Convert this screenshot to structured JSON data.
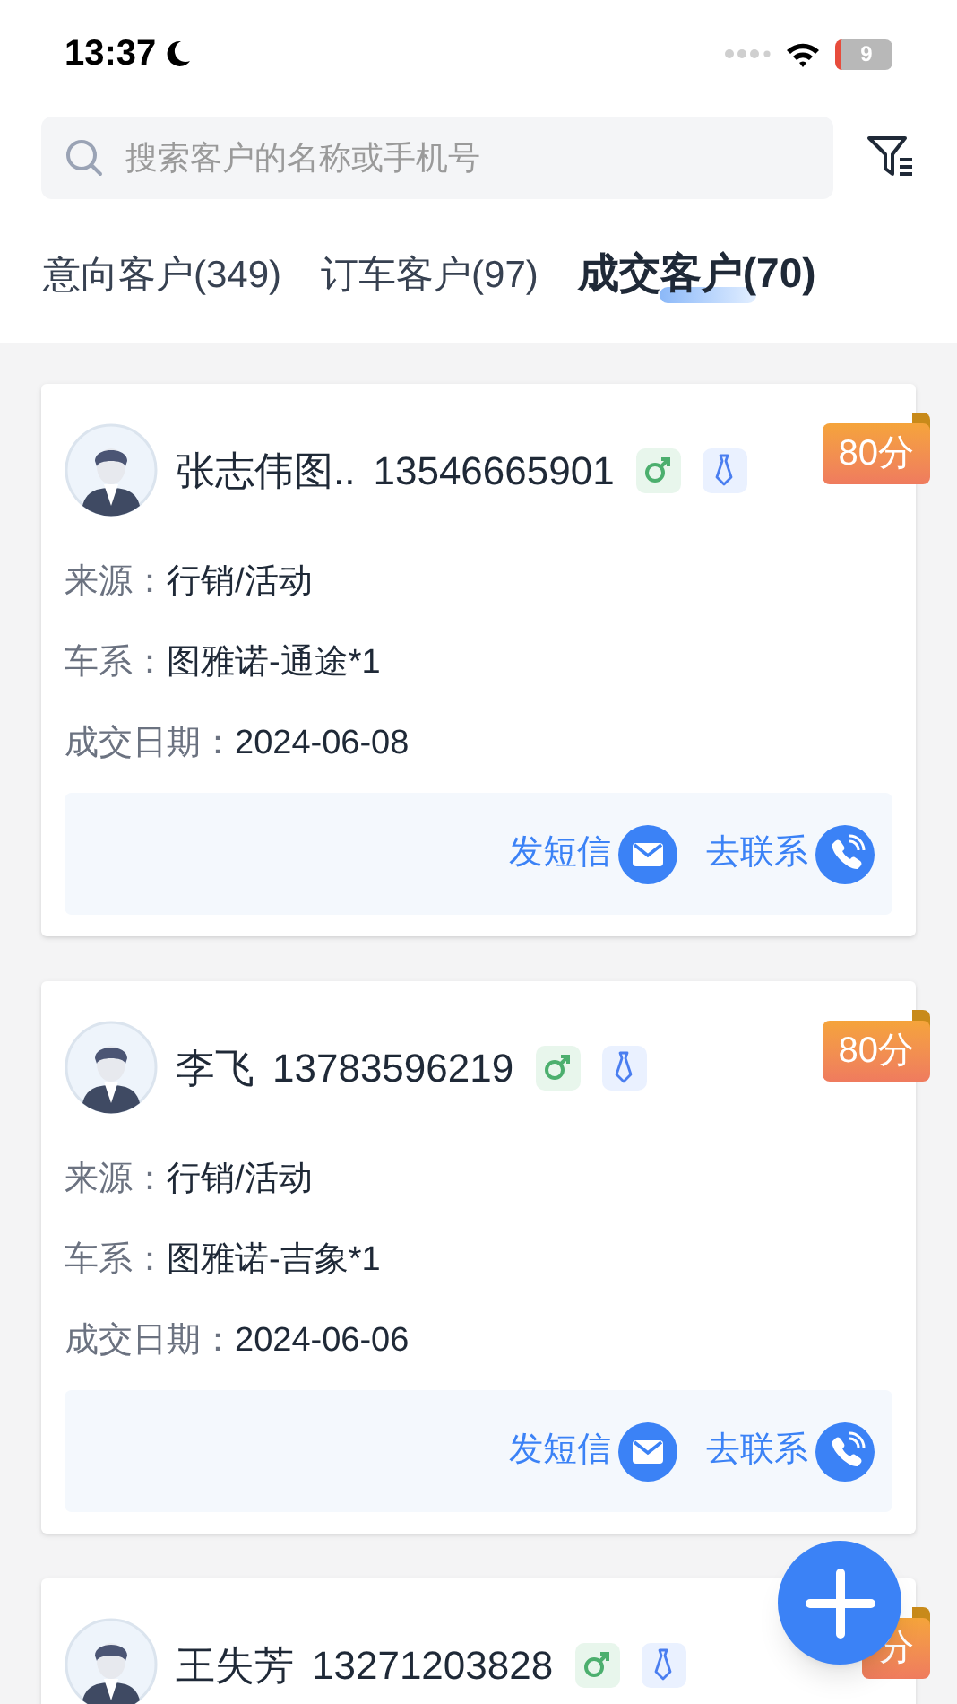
{
  "status_bar": {
    "time": "13:37",
    "battery": "9"
  },
  "search": {
    "placeholder": "搜索客户的名称或手机号"
  },
  "tabs": [
    {
      "label": "意向客户(349)",
      "selected": false
    },
    {
      "label": "订车客户(97)",
      "selected": false
    },
    {
      "label": "成交客户(70)",
      "selected": true
    }
  ],
  "customers": [
    {
      "name": "张志伟图..",
      "phone": "13546665901",
      "score": "80分",
      "fields": [
        {
          "label": "来源：",
          "value": "行销/活动"
        },
        {
          "label": "车系：",
          "value": "图雅诺-通途*1"
        },
        {
          "label": "成交日期：",
          "value": "2024-06-08"
        }
      ],
      "actions": [
        "发短信",
        "去联系"
      ]
    },
    {
      "name": "李飞",
      "phone": "13783596219",
      "score": "80分",
      "fields": [
        {
          "label": "来源：",
          "value": "行销/活动"
        },
        {
          "label": "车系：",
          "value": "图雅诺-吉象*1"
        },
        {
          "label": "成交日期：",
          "value": "2024-06-06"
        }
      ],
      "actions": [
        "发短信",
        "去联系"
      ]
    },
    {
      "name": "王失芳",
      "phone": "13271203828",
      "score": "分"
    }
  ]
}
